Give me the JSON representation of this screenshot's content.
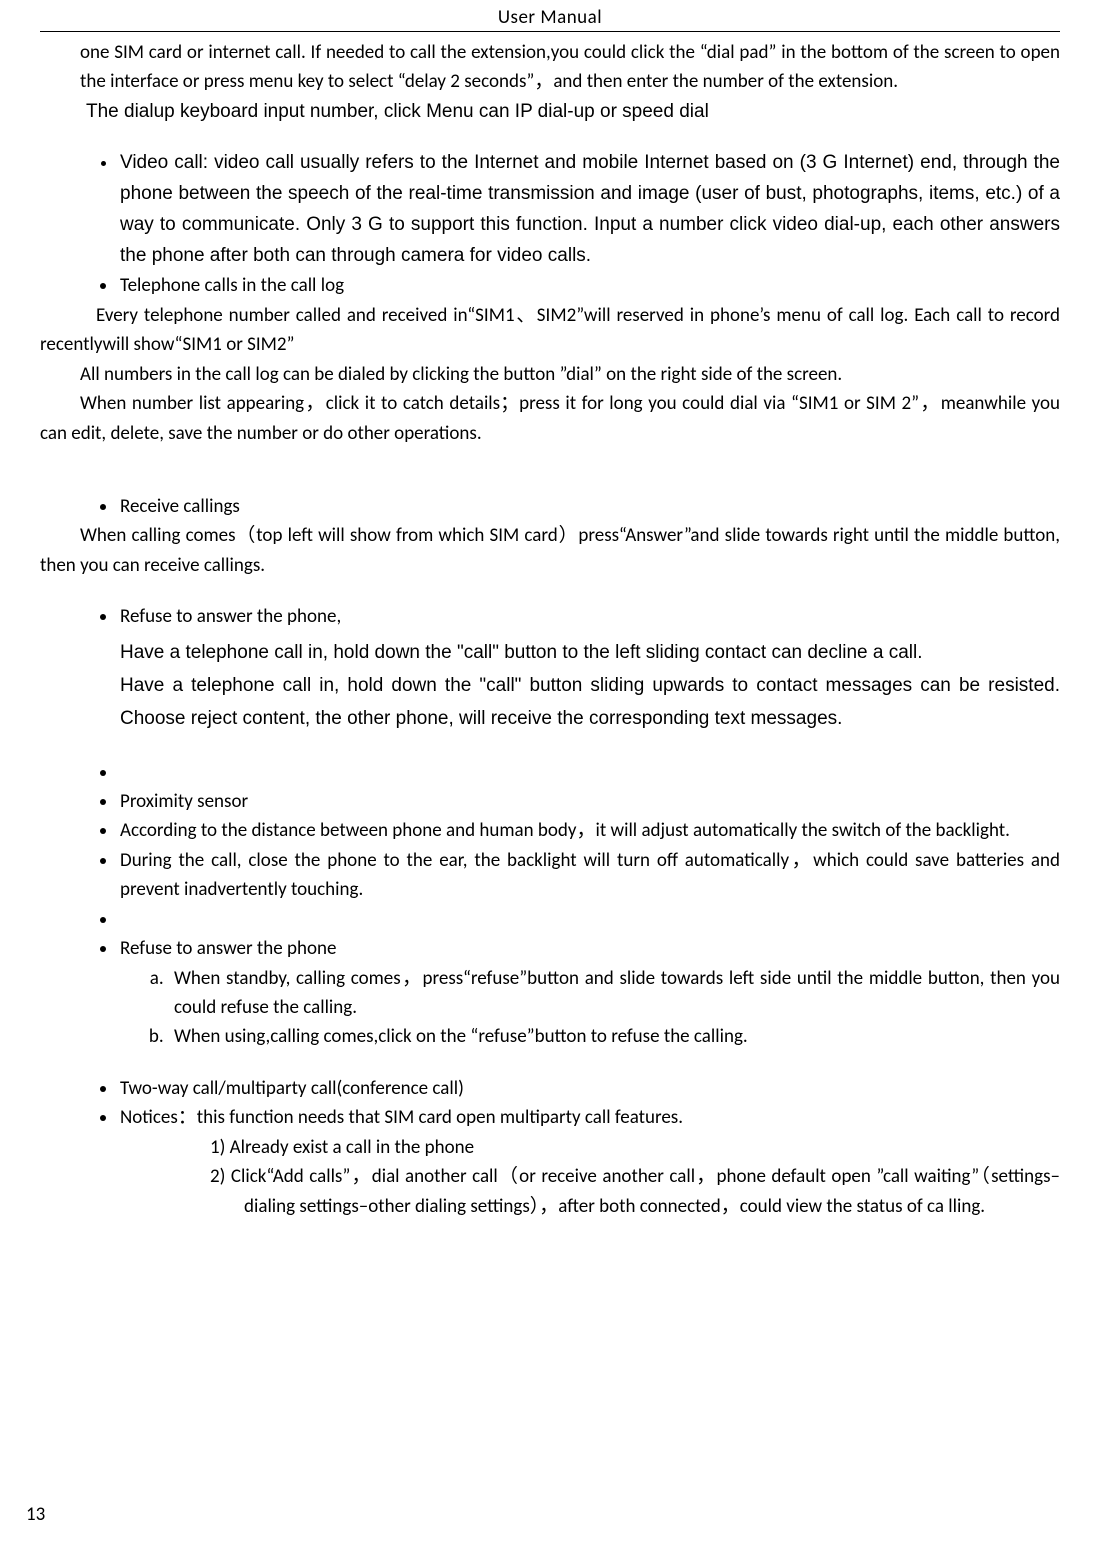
{
  "header": {
    "title": "User    Manual"
  },
  "page_number": "13",
  "intro": {
    "p1": "one SIM card or internet call. If needed to call the extension,you could click the “dial pad” in the bottom of the screen to open the interface or press menu key to select “delay 2 seconds”，and then enter the number of the extension.",
    "p2": "The dialup keyboard input number, click Menu can IP dial-up or speed dial"
  },
  "bullets1": {
    "video_call": "Video call: video call usually refers to the Internet and mobile Internet based on (3 G Internet) end, through the phone between the speech of the real-time transmission and image (user of bust, photographs, items, etc.) of a way to communicate. Only 3 G to support this function. Input a number click video dial-up, each other answers the phone after both can through camera for video calls.",
    "tel_log": "Telephone calls in the call log"
  },
  "calllog": {
    "p1": "Every telephone number called and received in“SIM1、SIM2”will reserved in phone’s menu of call log. Each call to record recentlywill show“SIM1 or SIM2”",
    "p2": "All numbers in the call log can be dialed by clicking the button ”dial” on the right side of the screen.",
    "p3": "When number list appearing，click it to catch details；press it for long you could dial via “SIM1 or SIM 2”，meanwhile you can edit, delete, save the number or do other operations."
  },
  "receive": {
    "title": "Receive callings",
    "p1": "When calling comes（top left will show from which SIM card）press“Answer”and slide towards right until the middle button, then you can receive callings."
  },
  "refuse1": {
    "title": "Refuse to answer the phone,",
    "p1": "Have a telephone call in, hold down the \"call\" button to the left sliding contact can decline a call.",
    "p2": "Have a telephone call in, hold down the \"call\" button sliding upwards to contact messages can be resisted. Choose reject content, the other phone, will receive the corresponding text messages."
  },
  "proximity": {
    "title": "Proximity sensor",
    "p1": "According to the distance between phone and human body，it will adjust automatically the switch of the backlight.",
    "p2": "During the call, close the phone to the ear, the backlight will turn off automatically，which could save batteries and prevent inadvertently touching."
  },
  "refuse2": {
    "title": "Refuse to answer the phone",
    "a": "When standby, calling comes，press“refuse”button and slide towards left side until the middle button, then you could refuse the calling.",
    "b": "When using,calling comes,click on the “refuse”button to refuse the calling."
  },
  "twoway": {
    "title": "Two-way call/multiparty call(conference call)",
    "notices": "Notices：this function needs that SIM card open multiparty call features.",
    "n1": "1)    Already exist a call in the phone",
    "n2": "2)    Click“Add calls”，dial another call（or receive another call，phone default open ”call waiting”（settings–dialing settings–other dialing settings），after both connected，could view the status of ca    lling."
  }
}
